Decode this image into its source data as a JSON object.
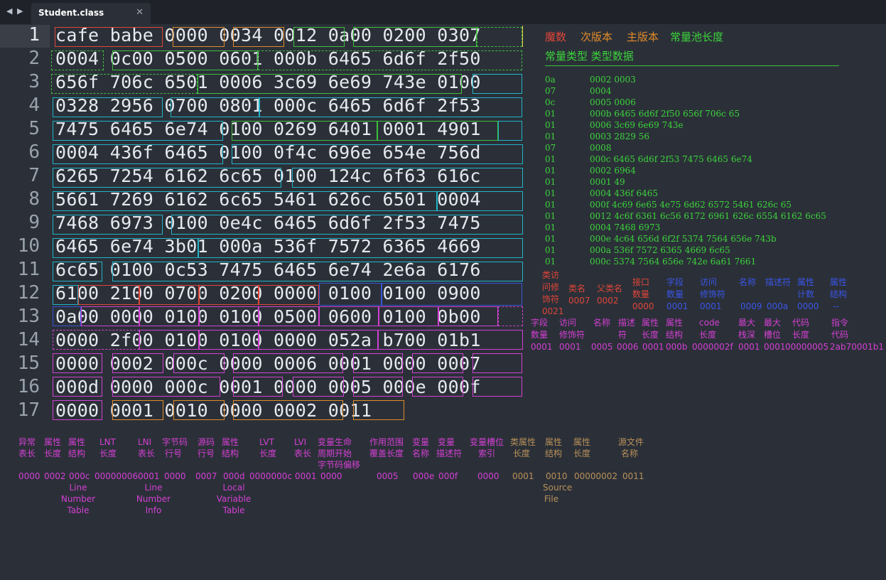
{
  "tabs": {
    "back_glyph": "◀",
    "forward_glyph": "▶",
    "active_title": "Student.class",
    "close_glyph": "✕"
  },
  "editor": {
    "current_line": 1,
    "line_numbers": [
      "1",
      "2",
      "3",
      "4",
      "5",
      "6",
      "7",
      "8",
      "9",
      "10",
      "11",
      "12",
      "13",
      "14",
      "15",
      "16",
      "17"
    ],
    "lines": [
      "cafe babe 0000 0034 0012 0a00 0200 0307",
      "0004 0c00 0500 0601 000b 6465 6d6f 2f50",
      "656f 706c 6501 0006 3c69 6e69 743e 0100",
      "0328 2956 0700 0801 000c 6465 6d6f 2f53",
      "7475 6465 6e74 0100 0269 6401 0001 4901",
      "0004 436f 6465 0100 0f4c 696e 654e 756d",
      "6265 7254 6162 6c65 0100 124c 6f63 616c",
      "5661 7269 6162 6c65 5461 626c 6501 0004",
      "7468 6973 0100 0e4c 6465 6d6f 2f53 7475",
      "6465 6e74 3b01 000a 536f 7572 6365 4669",
      "6c65 0100 0c53 7475 6465 6e74 2e6a 6176",
      "6100 2100 0700 0200 0000 0100 0100 0900",
      "0a00 0000 0100 0100 0500 0600 0100 0b00",
      "0000 2f00 0100 0100 0000 052a b700 01b1",
      "0000 0002 000c 0000 0006 0001 0000 0007",
      "000d 0000 000c 0001 0000 0005 000e 000f",
      "0000 0001 0010 0000 0002 0011"
    ]
  },
  "header_labels": {
    "magic": "魔数",
    "minor_version": "次版本",
    "major_version": "主版本",
    "cp_count": "常量池长度"
  },
  "constant_pool": {
    "header": "常量类型 类型数据",
    "entries": [
      {
        "type": "0a",
        "data": "0002 0003"
      },
      {
        "type": "07",
        "data": "0004"
      },
      {
        "type": "0c",
        "data": "0005 0006"
      },
      {
        "type": "01",
        "data": "000b 6465 6d6f 2f50 656f 706c 65"
      },
      {
        "type": "01",
        "data": "0006 3c69 6e69 743e"
      },
      {
        "type": "01",
        "data": "0003 2829 56"
      },
      {
        "type": "07",
        "data": "0008"
      },
      {
        "type": "01",
        "data": "000c 6465 6d6f 2f53 7475 6465 6e74"
      },
      {
        "type": "01",
        "data": "0002 6964"
      },
      {
        "type": "01",
        "data": "0001 49"
      },
      {
        "type": "01",
        "data": "0004 436f 6465"
      },
      {
        "type": "01",
        "data": "000f 4c69 6e65 4e75 6d62 6572 5461 626c 65"
      },
      {
        "type": "01",
        "data": "0012 4c6f 6361 6c56 6172 6961 626c 6554 6162 6c65"
      },
      {
        "type": "01",
        "data": "0004 7468 6973"
      },
      {
        "type": "01",
        "data": "000e 4c64 656d 6f2f 5374 7564 656e 743b"
      },
      {
        "type": "01",
        "data": "000a 536f 7572 6365 4669 6c65"
      },
      {
        "type": "01",
        "data": "000c 5374 7564 656e 742e 6a61 7661"
      }
    ]
  },
  "class_info": {
    "access_label_l1": "类访",
    "access_label_l2": "问修",
    "access_label_l3": "饰符",
    "access_value": "0021",
    "this_label": "类名",
    "this_value": "0007",
    "super_label": "父类名",
    "super_value": "0002",
    "iface_label_l1": "接口",
    "iface_label_l2": "数量",
    "iface_value": "0000",
    "fcount_label_l1": "字段",
    "fcount_label_l2": "数量",
    "fcount_value": "0001",
    "faccess_label_l1": "访问",
    "faccess_label_l2": "修饰符",
    "faccess_value": "0001",
    "fname_label": "名称",
    "fname_value": "0009",
    "fdesc_label": "描述符",
    "fdesc_value": "000a",
    "fattr_l1": "属性",
    "fattr_l2": "计数",
    "fattr_value": "0000",
    "fattr2_l1": "属性",
    "fattr2_l2": "结构",
    "fattr2_value": "--"
  },
  "method_info": {
    "mcount_l1": "字段",
    "mcount_l2": "数量",
    "mcount_value": "0001",
    "maccess_l1": "访问",
    "maccess_l2": "修饰符",
    "maccess_value": "0001",
    "mname_label": "名称",
    "mname_value": "0005",
    "mdesc_l1": "描述",
    "mdesc_l2": "符",
    "mdesc_value": "0006",
    "mattrlen_l1": "属性",
    "mattrlen_l2": "长度",
    "mattrlen_value": "0001",
    "mattrstruct_l1": "属性",
    "mattrstruct_l2": "结构",
    "mattrstruct_value": "000b",
    "codelen_l1": "code",
    "codelen_l2": "长度",
    "codelen_value": "0000002f",
    "maxstack_l1": "最大",
    "maxstack_l2": "栈深",
    "maxstack_value": "0001",
    "maxlocals_l1": "最大",
    "maxlocals_l2": "槽位",
    "maxlocals_value": "0001",
    "bytecodelen_l1": "代码",
    "bytecodelen_l2": "长度",
    "bytecodelen_value": "00000005",
    "instr_l1": "指令",
    "instr_l2": "代码",
    "instr_value": "2ab70001b1"
  },
  "bottom": {
    "exc_l1": "异常",
    "exc_l2": "表长",
    "exc_value": "0000",
    "attrlen_l1": "属性",
    "attrlen_l2": "长度",
    "attrlen_value": "0002",
    "attrstruct_l1": "属性",
    "attrstruct_l2": "结构",
    "attrstruct_value": "000c",
    "lntstruct_l1": "Line",
    "lntstruct_l2": "Number",
    "lntstruct_l3": "Table",
    "lnt_l1": "LNT",
    "lnt_l2": "长度",
    "lnt_value": "00000006",
    "lni_l1": "LNI",
    "lni_l2": "表长",
    "lni_value": "0001",
    "lni_n1": "Line",
    "lni_n2": "Number",
    "lni_n3": "Info",
    "bcline_l1": "字节码",
    "bcline_l2": "行号",
    "bcline_value": "0000",
    "srcline_l1": "源码",
    "srcline_l2": "行号",
    "srcline_value": "0007",
    "attr3_l1": "属性",
    "attr3_l2": "结构",
    "attr3_value": "000d",
    "lvtname_l1": "Local",
    "lvtname_l2": "Variable",
    "lvtname_l3": "Table",
    "lvt_l1": "LVT",
    "lvt_l2": "长度",
    "lvt_value": "0000000c",
    "lvi_l1": "LVI",
    "lvi_l2": "表长",
    "lvi_value": "0001",
    "var_l1": "变量生命",
    "var_l2": "周期开始",
    "var_l3": "字节码偏移",
    "var_value": "0000",
    "scope_l1": "作用范围",
    "scope_l2": "覆盖长度",
    "scope_value": "0005",
    "vname_l1": "变量",
    "vname_l2": "名称",
    "vname_value": "000e",
    "vdesc_l1": "变量",
    "vdesc_l2": "描述符",
    "vdesc_value": "000f",
    "slot_l1": "变量槽位",
    "slot_l2": "索引",
    "slot_value": "0000",
    "cattr_l1": "类属性",
    "cattr_l2": "长度",
    "cattr_value": "0001",
    "cstruct_l1": "属性",
    "cstruct_l2": "结构",
    "cstruct_value": "0010",
    "sf_l1": "Source",
    "sf_l2": "File",
    "clen_l1": "属性",
    "clen_l2": "长度",
    "clen_value": "00000002",
    "src_l1": "源文件",
    "src_l2": "名称",
    "src_value": "0011"
  }
}
